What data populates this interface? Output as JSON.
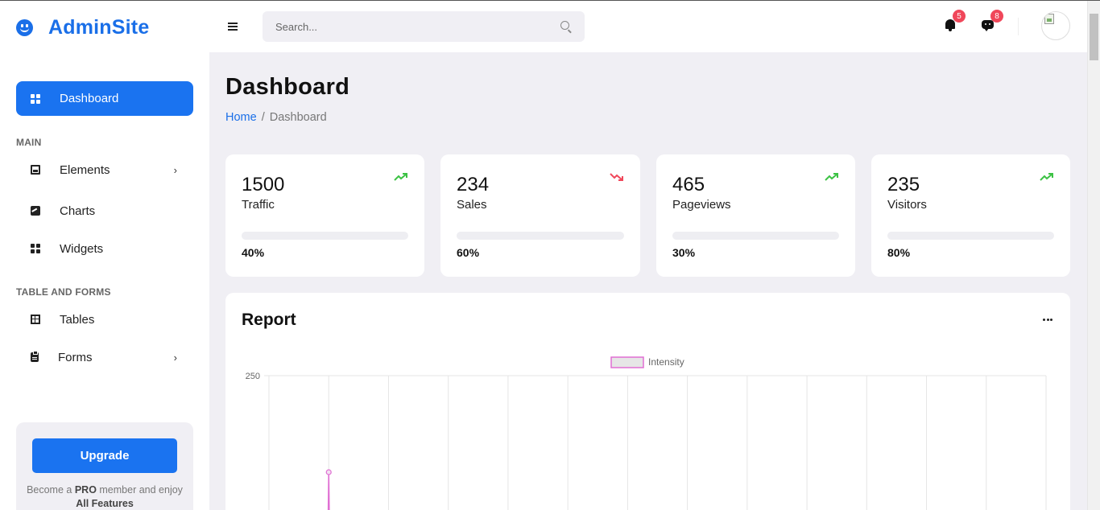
{
  "brand": {
    "name": "AdminSite"
  },
  "sidebar": {
    "active": {
      "label": "Dashboard"
    },
    "sections": [
      {
        "title": "MAIN"
      },
      {
        "title": "TABLE AND FORMS"
      }
    ],
    "items": [
      {
        "label": "Elements",
        "icon": "image-icon",
        "has_submenu": true
      },
      {
        "label": "Charts",
        "icon": "chart-icon",
        "has_submenu": false
      },
      {
        "label": "Widgets",
        "icon": "widgets-icon",
        "has_submenu": false
      },
      {
        "label": "Tables",
        "icon": "table-icon",
        "has_submenu": false
      },
      {
        "label": "Forms",
        "icon": "clipboard-icon",
        "has_submenu": true
      }
    ],
    "upgrade": {
      "button": "Upgrade",
      "text_1": "Become a ",
      "text_pro": "PRO",
      "text_2": " member and enjoy ",
      "text_features": "All Features"
    }
  },
  "topbar": {
    "search_placeholder": "Search...",
    "notifications_count": "5",
    "messages_count": "8"
  },
  "page": {
    "title": "Dashboard",
    "breadcrumb": {
      "home": "Home",
      "separator": "/",
      "current": "Dashboard"
    }
  },
  "stats": [
    {
      "value": "1500",
      "label": "Traffic",
      "percent": "40%",
      "progress": 0.4,
      "trend": "up"
    },
    {
      "value": "234",
      "label": "Sales",
      "percent": "60%",
      "progress": 0.6,
      "trend": "down"
    },
    {
      "value": "465",
      "label": "Pageviews",
      "percent": "30%",
      "progress": 0.3,
      "trend": "up"
    },
    {
      "value": "235",
      "label": "Visitors",
      "percent": "80%",
      "progress": 0.8,
      "trend": "up"
    }
  ],
  "report": {
    "title": "Report",
    "menu_icon": "more-dots-icon"
  },
  "chart_data": {
    "type": "line",
    "legend": [
      "Intensity"
    ],
    "legend_position": "top-center",
    "y_tick_labels": [
      "250"
    ],
    "ylim_top": 250,
    "grid": true,
    "series": [
      {
        "name": "Intensity",
        "color": "#e06fd3",
        "values": [
          null,
          150
        ]
      }
    ]
  },
  "colors": {
    "accent": "#1a73f0",
    "trend_up": "#3cc244",
    "trend_down": "#f0475a",
    "badge": "#f0475a"
  }
}
